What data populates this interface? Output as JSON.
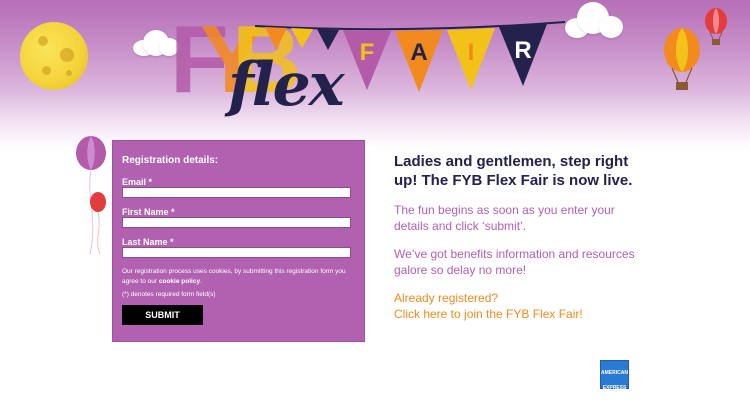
{
  "colors": {
    "panel_purple": "#b161b0",
    "navy": "#23224d",
    "orange": "#f28a1e",
    "yellow": "#f3c219",
    "amex_blue": "#2a7ad4"
  },
  "logo": {
    "letters": [
      "F",
      "Y",
      "B"
    ],
    "script": "flex",
    "bunting_letters": [
      "F",
      "A",
      "I",
      "R"
    ]
  },
  "registration": {
    "title": "Registration details:",
    "fields": [
      {
        "label": "Email *",
        "value": ""
      },
      {
        "label": "First Name *",
        "value": ""
      },
      {
        "label": "Last Name *",
        "value": ""
      }
    ],
    "notice_prefix": "Our registration process uses cookies, by submitting this registration form you agree to our",
    "cookie_link": "cookie policy",
    "notice_suffix": ".",
    "required_note": "(*) denotes required form field(s)",
    "submit_label": "SUBMIT"
  },
  "copy": {
    "headline": "Ladies and gentlemen, step right up! The FYB Flex Fair is now live.",
    "para1": "The fun begins as soon as you enter your details and click ‘submit’.",
    "para2": "We’ve got benefits information and resources galore so delay no more!",
    "already": "Already registered?",
    "join_link": "Click here to join the FYB Flex Fair!"
  },
  "amex": {
    "line1": "AMERICAN",
    "line2": "EXPRESS"
  }
}
